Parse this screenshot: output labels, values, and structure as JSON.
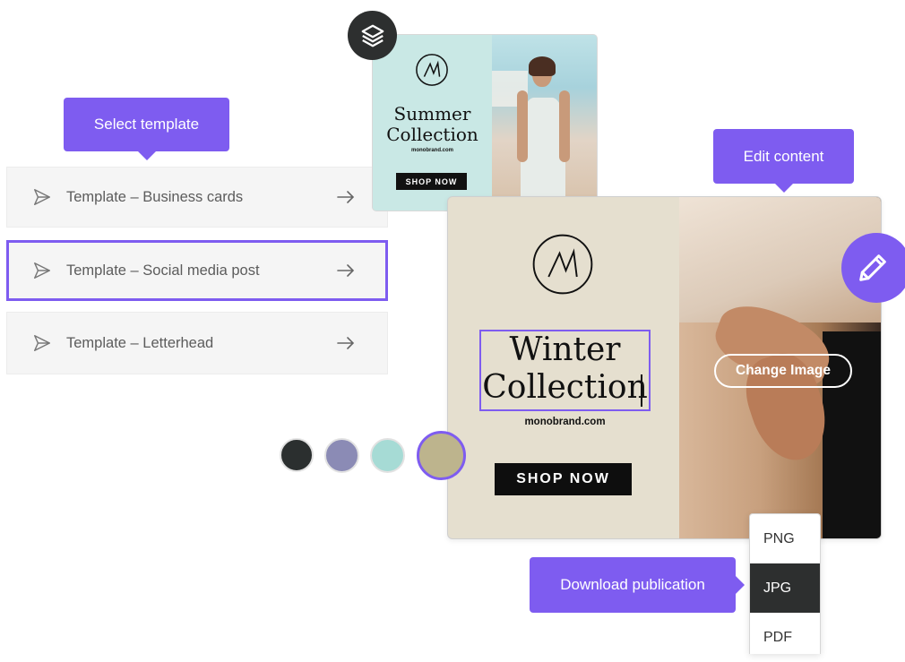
{
  "tooltips": {
    "select_template": "Select template",
    "edit_content": "Edit content",
    "download_publication": "Download publication"
  },
  "templates": [
    {
      "label": "Template – Business cards",
      "selected": false
    },
    {
      "label": "Template – Social media post",
      "selected": true
    },
    {
      "label": "Template – Letterhead",
      "selected": false
    }
  ],
  "summer_card": {
    "title_line1": "Summer",
    "title_line2": "Collection",
    "domain": "monobrand.com",
    "cta": "SHOP NOW",
    "layers_icon": "layers-icon"
  },
  "winter_card": {
    "title_line1": "Winter",
    "title_line2": "Collection",
    "domain": "monobrand.com",
    "cta": "SHOP NOW",
    "change_image_label": "Change Image",
    "edit_icon": "pencil-icon"
  },
  "color_swatches": [
    {
      "name": "charcoal",
      "color": "#2b2f2f",
      "selected": false
    },
    {
      "name": "lavender",
      "color": "#8b8bb5",
      "selected": false
    },
    {
      "name": "mint",
      "color": "#a6dbd5",
      "selected": false
    },
    {
      "name": "sand",
      "color": "#bdb48d",
      "selected": true
    }
  ],
  "download_formats": [
    {
      "label": "PNG",
      "selected": false
    },
    {
      "label": "JPG",
      "selected": true
    },
    {
      "label": "PDF",
      "selected": false
    }
  ],
  "colors": {
    "accent": "#7e5cf0",
    "summer_bg": "#c9e8e5",
    "winter_bg": "#e5dfcf",
    "dark": "#2d2f2f"
  }
}
